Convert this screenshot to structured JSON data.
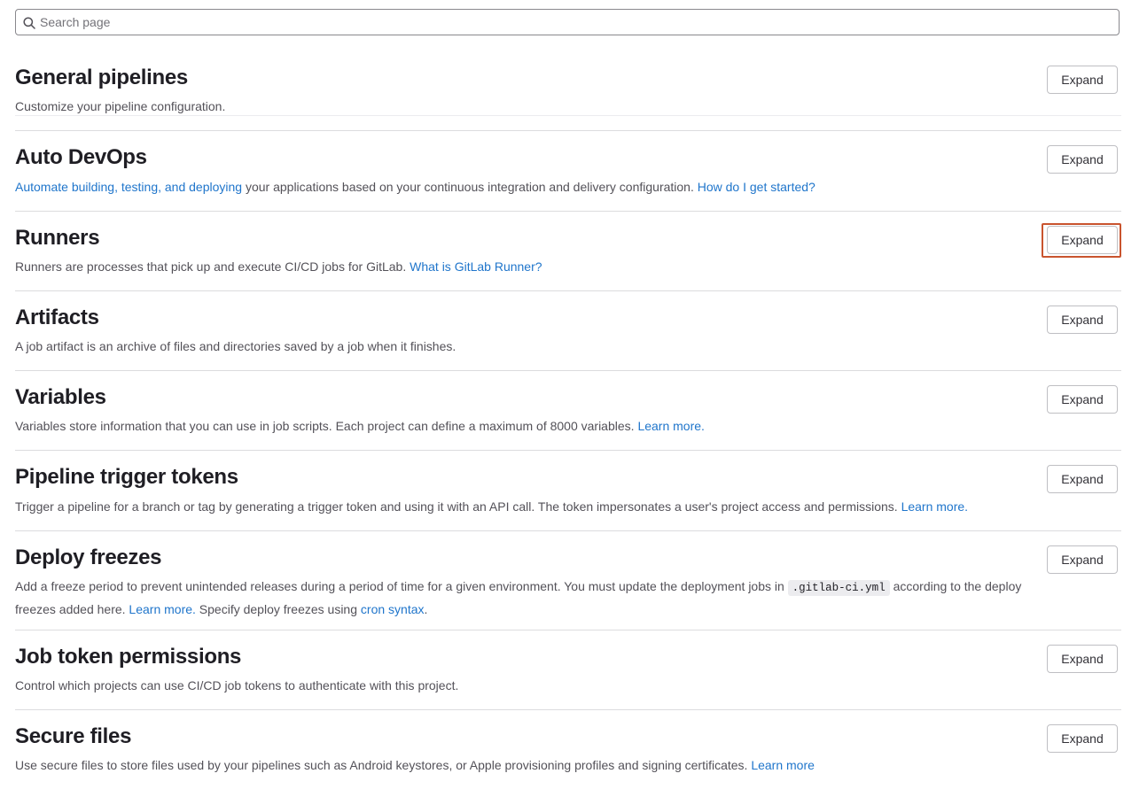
{
  "search": {
    "placeholder": "Search page"
  },
  "expand_label": "Expand",
  "sections": {
    "general_pipelines": {
      "title": "General pipelines",
      "desc": "Customize your pipeline configuration."
    },
    "auto_devops": {
      "title": "Auto DevOps",
      "link1": "Automate building, testing, and deploying",
      "text1": " your applications based on your continuous integration and delivery configuration. ",
      "link2": "How do I get started?"
    },
    "runners": {
      "title": "Runners",
      "text1": "Runners are processes that pick up and execute CI/CD jobs for GitLab. ",
      "link1": "What is GitLab Runner?"
    },
    "artifacts": {
      "title": "Artifacts",
      "desc": "A job artifact is an archive of files and directories saved by a job when it finishes."
    },
    "variables": {
      "title": "Variables",
      "text1": "Variables store information that you can use in job scripts. Each project can define a maximum of 8000 variables. ",
      "link1": "Learn more."
    },
    "trigger_tokens": {
      "title": "Pipeline trigger tokens",
      "text1": "Trigger a pipeline for a branch or tag by generating a trigger token and using it with an API call. The token impersonates a user's project access and permissions. ",
      "link1": "Learn more."
    },
    "deploy_freezes": {
      "title": "Deploy freezes",
      "text1": "Add a freeze period to prevent unintended releases during a period of time for a given environment. You must update the deployment jobs in ",
      "code1": ".gitlab-ci.yml",
      "text2": " according to the deploy freezes added here. ",
      "link1": "Learn more.",
      "text3": " Specify deploy freezes using ",
      "link2": "cron syntax",
      "text4": "."
    },
    "job_token": {
      "title": "Job token permissions",
      "desc": "Control which projects can use CI/CD job tokens to authenticate with this project."
    },
    "secure_files": {
      "title": "Secure files",
      "text1": "Use secure files to store files used by your pipelines such as Android keystores, or Apple provisioning profiles and signing certificates. ",
      "link1": "Learn more"
    }
  },
  "colors": {
    "link": "#1f75cb",
    "highlight": "#c9542e",
    "divider": "#dcdcde"
  },
  "icons": {
    "search": "search-icon"
  }
}
